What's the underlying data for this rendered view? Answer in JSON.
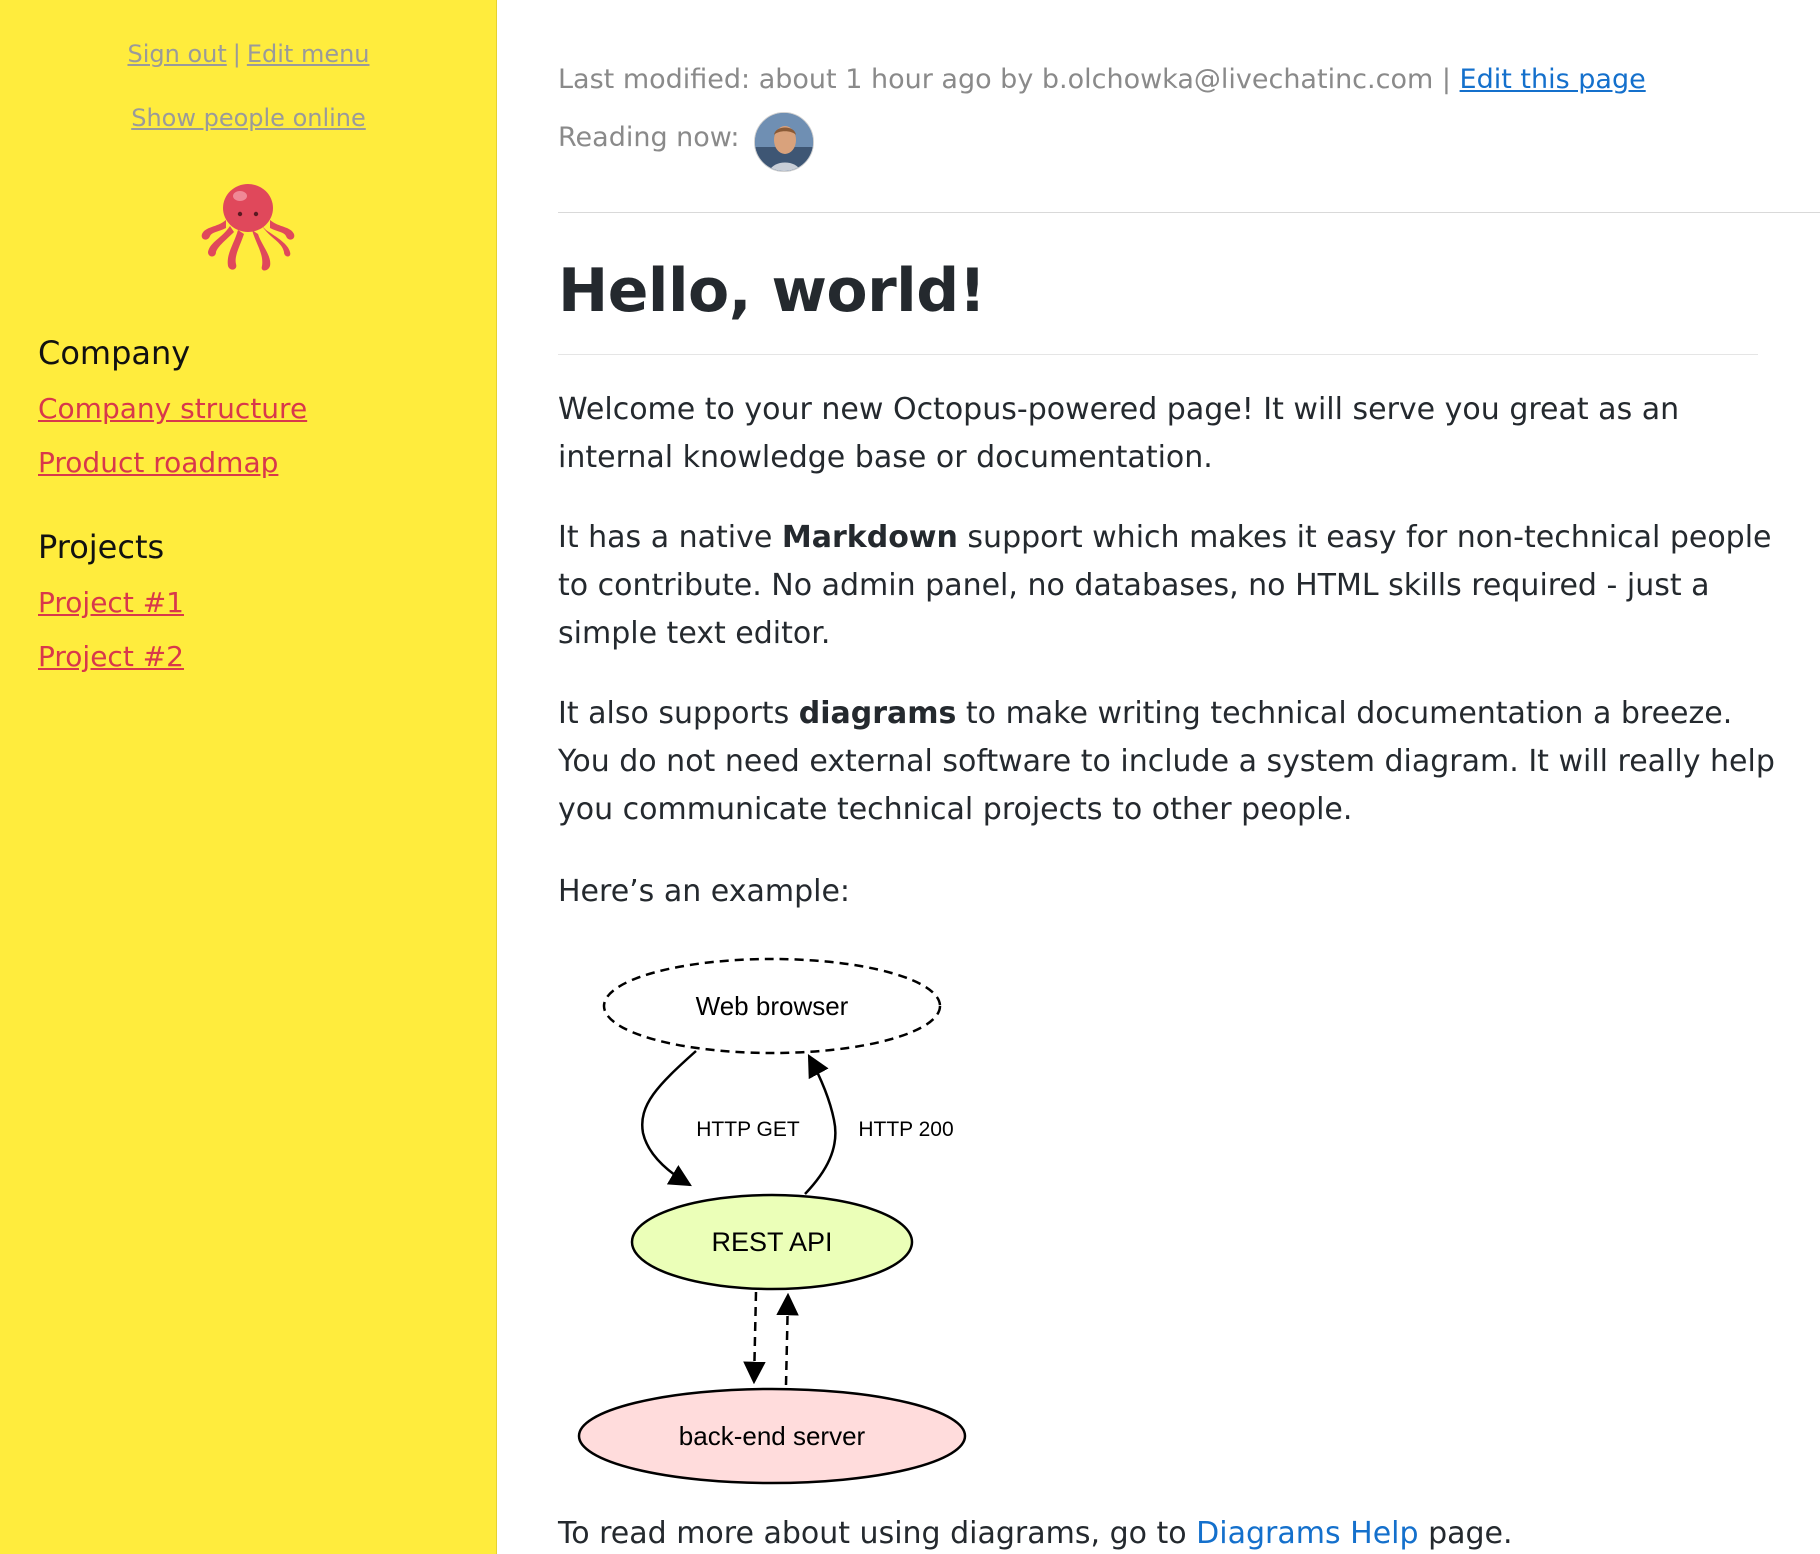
{
  "sidebar": {
    "sign_out": "Sign out",
    "separator": "|",
    "edit_menu": "Edit menu",
    "show_people_online": "Show people online",
    "logo_icon": "octopus-icon",
    "sections": [
      {
        "heading": "Company",
        "links": [
          "Company structure",
          "Product roadmap"
        ]
      },
      {
        "heading": "Projects",
        "links": [
          "Project #1",
          "Project #2"
        ]
      }
    ]
  },
  "header": {
    "last_modified": "Last modified: about 1 hour ago by b.olchowka@livechatinc.com |",
    "edit_page": "Edit this page",
    "reading_now": "Reading now:"
  },
  "content": {
    "title": "Hello, world!",
    "p1": "Welcome to your new Octopus-powered page! It will serve you great as an internal knowledge base or documentation.",
    "p2_before": "It has a native ",
    "p2_bold": "Markdown",
    "p2_after": " support which makes it easy for non-technical people to contribute. No admin panel, no databases, no HTML skills required - just a simple text editor.",
    "p3_before": "It also supports ",
    "p3_bold": "diagrams",
    "p3_after": " to make writing technical documentation a breeze. You do not need external software to include a system diagram. It will really help you communicate technical projects to other people.",
    "p4": "Here’s an example:",
    "p5_before": "To read more about using diagrams, go to ",
    "p5_link": "Diagrams Help",
    "p5_after": " page."
  },
  "diagram": {
    "nodes": {
      "browser": "Web browser",
      "api": "REST API",
      "backend": "back-end server"
    },
    "edges": {
      "get": "HTTP GET",
      "ok": "HTTP 200"
    },
    "colors": {
      "api_fill": "#ebffb8",
      "backend_fill": "#ffdcdc"
    }
  },
  "colors": {
    "sidebar_bg": "#ffec3d",
    "sidebar_link": "#d8384b",
    "main_link": "#1470cc"
  }
}
